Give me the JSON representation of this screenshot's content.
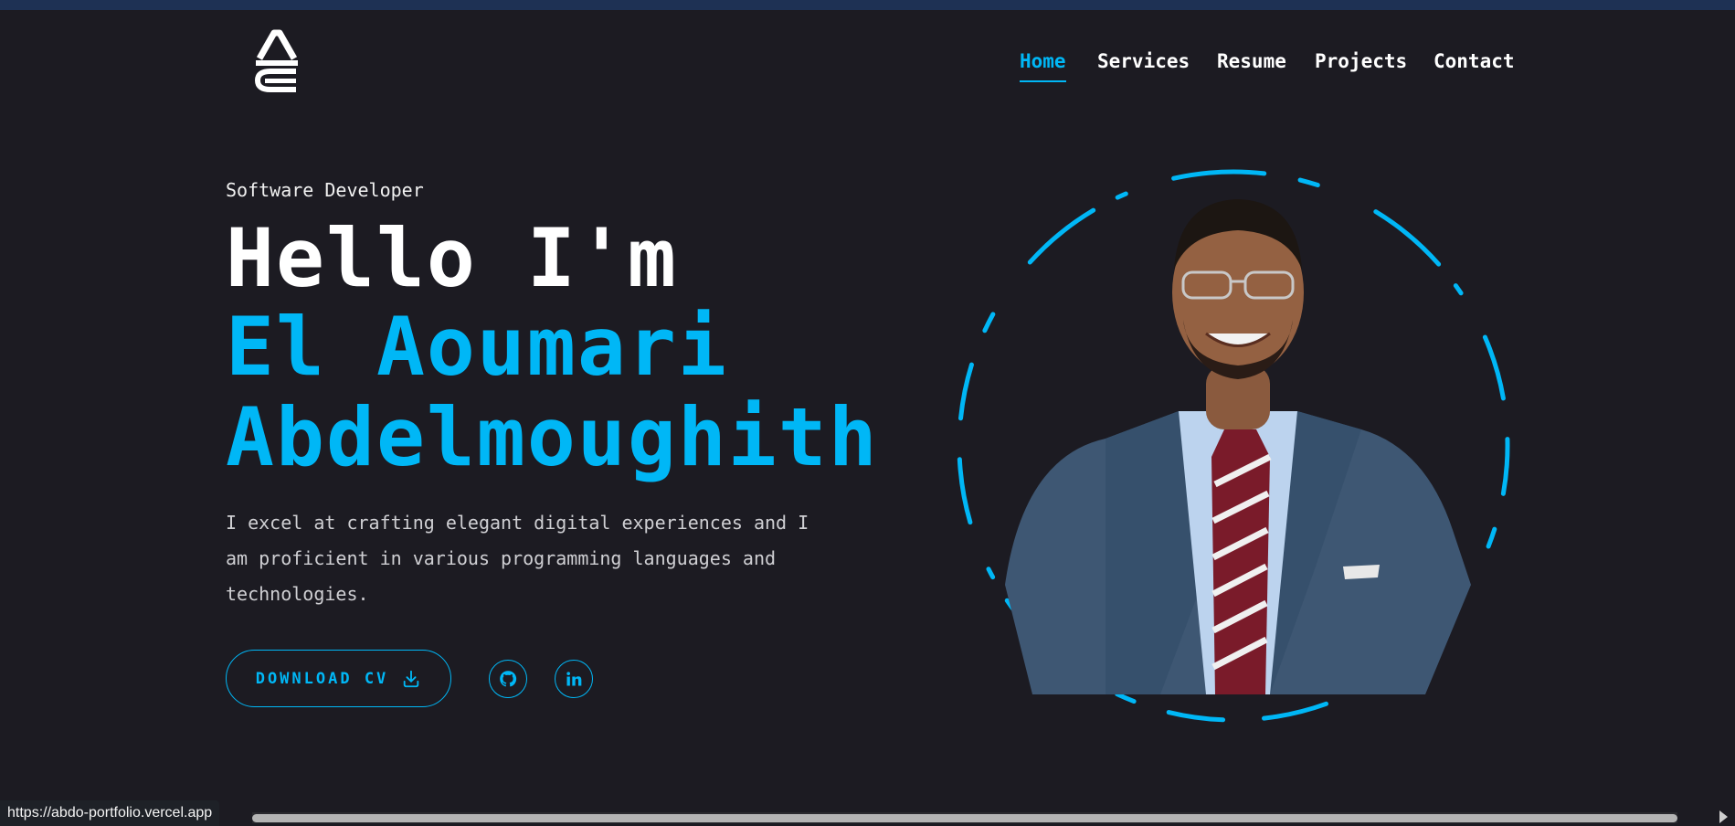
{
  "nav": {
    "items": [
      {
        "label": "Home",
        "active": true
      },
      {
        "label": "Services",
        "active": false
      },
      {
        "label": "Resume",
        "active": false
      },
      {
        "label": "Projects",
        "active": false
      },
      {
        "label": "Contact",
        "active": false
      }
    ]
  },
  "hero": {
    "role": "Software Developer",
    "greeting": "Hello I'm",
    "name_line1": "El Aoumari",
    "name_line2": "Abdelmoughith",
    "description": "I excel at crafting elegant digital experiences and I am proficient in various programming languages and technologies.",
    "download_label": "DOWNLOAD CV",
    "download_icon": "download-icon",
    "socials": [
      {
        "icon": "github-icon"
      },
      {
        "icon": "linkedin-icon"
      }
    ]
  },
  "statusbar": {
    "url": "https://abdo-portfolio.vercel.app"
  },
  "colors": {
    "background": "#1c1b22",
    "accent": "#00b7f6",
    "text": "#ffffff"
  }
}
